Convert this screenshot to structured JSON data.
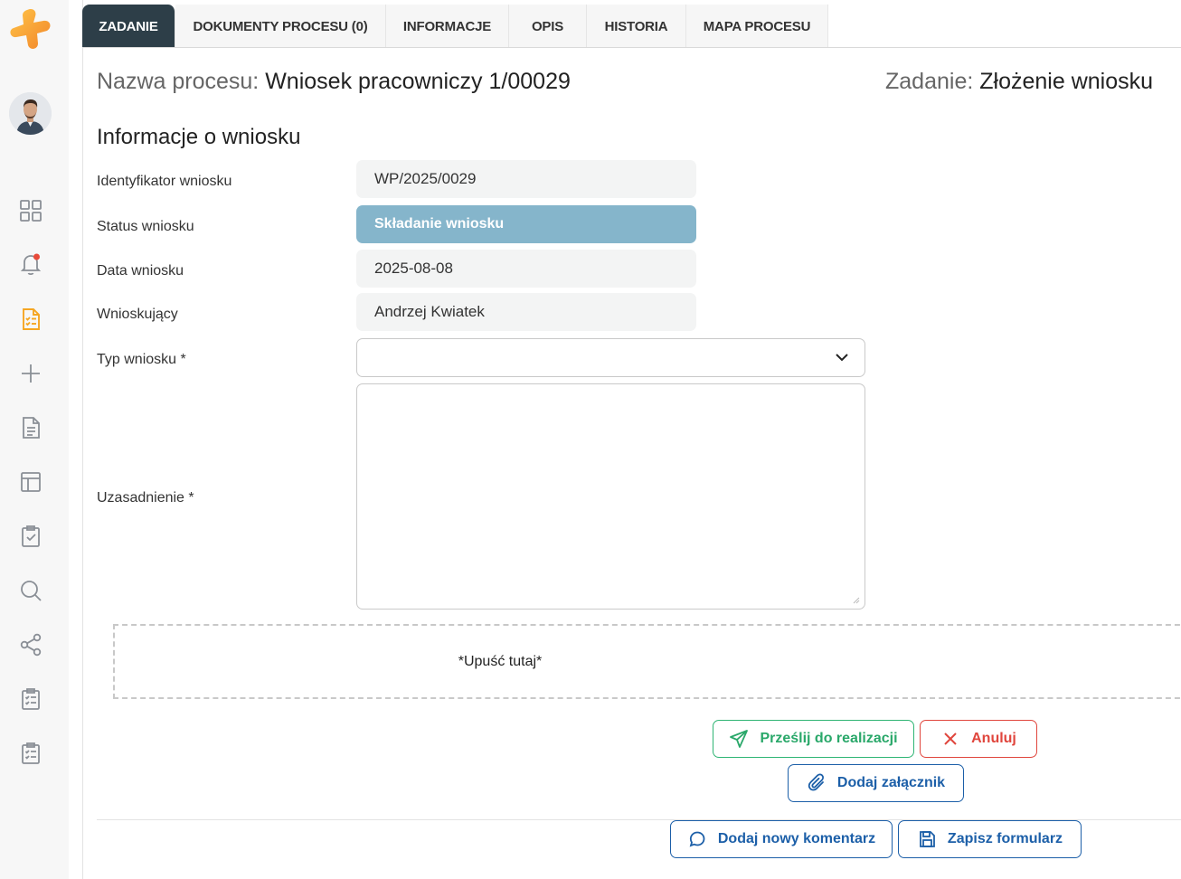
{
  "tabs": [
    {
      "label": "ZADANIE",
      "active": true
    },
    {
      "label": "DOKUMENTY PROCESU (0)",
      "active": false
    },
    {
      "label": "INFORMACJE",
      "active": false
    },
    {
      "label": "OPIS",
      "active": false
    },
    {
      "label": "HISTORIA",
      "active": false
    },
    {
      "label": "MAPA PROCESU",
      "active": false
    }
  ],
  "header": {
    "process_label": "Nazwa procesu:",
    "process_name": "Wniosek pracowniczy 1/00029",
    "task_label": "Zadanie:",
    "task_name": "Złożenie wniosku"
  },
  "section_title": "Informacje o wniosku",
  "form": {
    "identifier": {
      "label": "Identyfikator wniosku",
      "value": "WP/2025/0029"
    },
    "status": {
      "label": "Status wniosku",
      "value": "Składanie wniosku"
    },
    "date": {
      "label": "Data wniosku",
      "value": "2025-08-08"
    },
    "applicant": {
      "label": "Wnioskujący",
      "value": "Andrzej Kwiatek"
    },
    "type": {
      "label": "Typ wniosku *",
      "value": ""
    },
    "justification": {
      "label": "Uzasadnienie *",
      "value": ""
    }
  },
  "dropzone_text": "*Upuść tutaj*",
  "buttons": {
    "submit": "Prześlij do realizacji",
    "cancel": "Anuluj",
    "attach": "Dodaj załącznik",
    "comment": "Dodaj nowy komentarz",
    "save": "Zapisz formularz"
  },
  "sidebar": {
    "icons": [
      "dashboard-icon",
      "notifications-icon",
      "tasks-icon",
      "add-icon",
      "document-icon",
      "layout-icon",
      "checklist-icon",
      "search-icon",
      "share-icon",
      "clipboard-list-icon",
      "clipboard-list-2-icon"
    ]
  },
  "colors": {
    "accent": "#f5a623",
    "active_tab": "#2d3e48",
    "status_bg": "#85b5cb",
    "green": "#2fb574",
    "red": "#e0463d",
    "blue": "#1c5fa8",
    "notification_dot": "#e84a3a"
  }
}
